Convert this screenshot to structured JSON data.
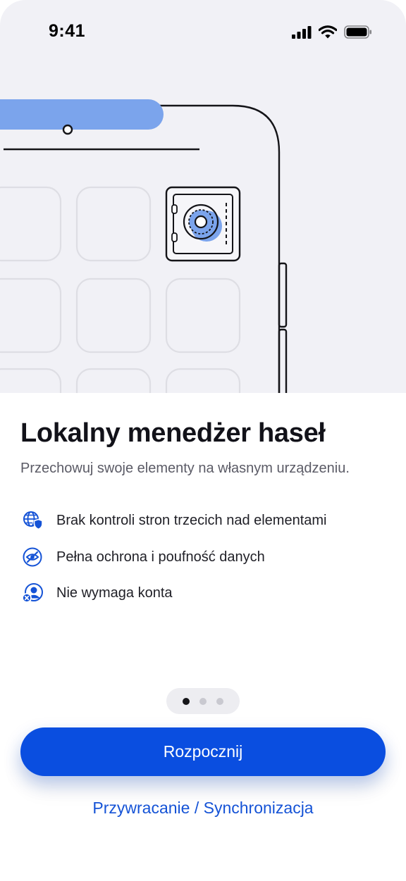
{
  "status_bar": {
    "time": "9:41",
    "icons": [
      "cellular-signal-icon",
      "wifi-icon",
      "battery-icon"
    ]
  },
  "hero": {
    "illustration": "phone-with-safe-app-icon",
    "accent_color": "#7ba4ec"
  },
  "onboarding": {
    "title": "Lokalny menedżer haseł",
    "subtitle": "Przechowuj swoje elementy na własnym urządzeniu.",
    "features": [
      {
        "icon": "globe-shield-icon",
        "label": "Brak kontroli stron trzecich nad elementami"
      },
      {
        "icon": "eye-slash-icon",
        "label": "Pełna ochrona i poufność danych"
      },
      {
        "icon": "user-no-account-icon",
        "label": "Nie wymaga konta"
      }
    ]
  },
  "pager": {
    "total": 3,
    "active_index": 0
  },
  "actions": {
    "primary_label": "Rozpocznij",
    "secondary_label": "Przywracanie / Synchronizacja"
  },
  "colors": {
    "primary": "#0a4ee0",
    "link": "#1553d6",
    "hero_background": "#f1f1f6",
    "icon_blue": "#1553d6"
  }
}
